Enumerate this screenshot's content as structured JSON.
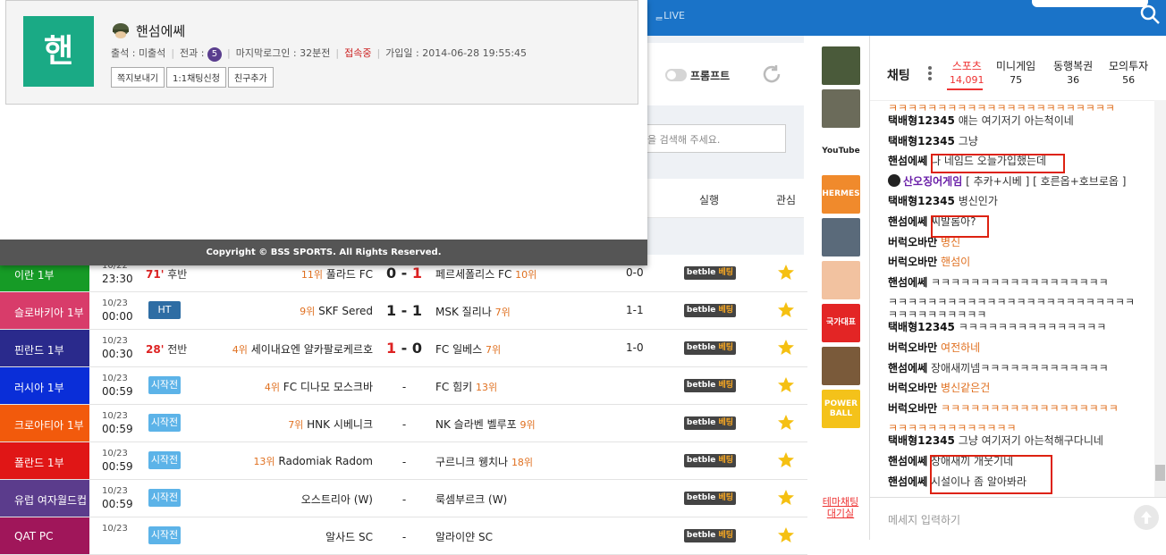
{
  "topbar": {
    "label": "ᆯLIVE"
  },
  "filter": {
    "toggle_label": "프롬프트",
    "search_placeholder": "을 검색해 주세요."
  },
  "table": {
    "header_exec": "실행",
    "header_fav": "관심"
  },
  "matches": [
    {
      "league": "이란 1부",
      "league_color": "#169b26",
      "date": "10/22",
      "time": "23:30",
      "status_type": "live",
      "minute": "71'",
      "phase": "후반",
      "home": "풀라드 FC",
      "home_rank": "11위",
      "score_home": "0",
      "score_away": "1",
      "away": "페르세폴리스 FC",
      "away_rank": "10위",
      "ht": "0-0",
      "bet": "betble",
      "bet2": "베팅"
    },
    {
      "league": "슬로바키아 1부",
      "league_color": "#d83c6a",
      "date": "10/23",
      "time": "00:00",
      "status_type": "ht",
      "status": "HT",
      "home": "SKF Sered",
      "home_rank": "9위",
      "score_home": "1",
      "score_away": "1",
      "away": "MSK 질리나",
      "away_rank": "7위",
      "ht": "1-1",
      "bet": "betble",
      "bet2": "베팅"
    },
    {
      "league": "핀란드 1부",
      "league_color": "#2a2a8c",
      "date": "10/23",
      "time": "00:30",
      "status_type": "live",
      "minute": "28'",
      "phase": "전반",
      "home": "세이내요엔 얄카팔로케르호",
      "home_rank": "4위",
      "score_home": "1",
      "score_away": "0",
      "away": "FC 일베스",
      "away_rank": "7위",
      "ht": "1-0",
      "bet": "betble",
      "bet2": "베팅"
    },
    {
      "league": "러시아 1부",
      "league_color": "#0a2ed8",
      "date": "10/23",
      "time": "00:59",
      "status_type": "pre",
      "status": "시작전",
      "home": "FC 디나모 모스크바",
      "home_rank": "4위",
      "score": "-",
      "away": "FC 힘키",
      "away_rank": "13위",
      "ht": "",
      "bet": "betble",
      "bet2": "베팅"
    },
    {
      "league": "크로아티아 1부",
      "league_color": "#f25a0c",
      "date": "10/23",
      "time": "00:59",
      "status_type": "pre",
      "status": "시작전",
      "home": "HNK 시베니크",
      "home_rank": "7위",
      "score": "-",
      "away": "NK 슬라벤 벨루포",
      "away_rank": "9위",
      "ht": "",
      "bet": "betble",
      "bet2": "베팅"
    },
    {
      "league": "폴란드 1부",
      "league_color": "#e01616",
      "date": "10/23",
      "time": "00:59",
      "status_type": "pre",
      "status": "시작전",
      "home": "Radomiak Radom",
      "home_rank": "13위",
      "score": "-",
      "away": "구르니크 웽치나",
      "away_rank": "18위",
      "ht": "",
      "bet": "betble",
      "bet2": "베팅"
    },
    {
      "league": "유럽 여자월드컵",
      "league_color": "#5b3c8c",
      "date": "10/23",
      "time": "00:59",
      "status_type": "pre",
      "status": "시작전",
      "home": "오스트리아 (W)",
      "home_rank": "",
      "score": "-",
      "away": "룩셈부르크 (W)",
      "away_rank": "",
      "ht": "",
      "bet": "betble",
      "bet2": "베팅"
    },
    {
      "league": "QAT PC",
      "league_color": "#a0165a",
      "date": "10/23",
      "time": "",
      "status_type": "pre",
      "status": "시작전",
      "home": "알사드 SC",
      "home_rank": "",
      "score": "-",
      "away": "알라이얀 SC",
      "away_rank": "",
      "ht": "",
      "bet": "betble",
      "bet2": "베팅"
    }
  ],
  "chat": {
    "title": "채팅",
    "tabs": [
      {
        "label": "스포츠",
        "count": "14,091",
        "active": true
      },
      {
        "label": "미니게임",
        "count": "75"
      },
      {
        "label": "동행복권",
        "count": "36"
      },
      {
        "label": "모의투자",
        "count": "56"
      }
    ],
    "messages": [
      {
        "user": "",
        "text": "ㅋㅋㅋㅋㅋㅋㅋㅋㅋㅋㅋㅋㅋㅋㅋㅋㅋㅋㅋㅋㅋㅋㅋ",
        "style": "o"
      },
      {
        "user": "택배형12345",
        "text": "얘는 여기저기 아는척이네",
        "style": "t"
      },
      {
        "user": "택배형12345",
        "text": "그냥",
        "style": "t"
      },
      {
        "user": "핸섬에쎄",
        "text": "나 네임드 오늘가입했는데",
        "style": "t"
      },
      {
        "user": "산오징어게임",
        "text": "[ 추카+시베 ] [ 호른옵+호브로옵 ]",
        "style": "t"
      },
      {
        "user": "택배형12345",
        "text": "병신인가",
        "style": "t"
      },
      {
        "user": "핸섬에쎄",
        "text": "씨발롬아?",
        "style": "t"
      },
      {
        "user": "버럭오바만",
        "text": "병신",
        "style": "o"
      },
      {
        "user": "버럭오바만",
        "text": "핸섬이",
        "style": "o"
      },
      {
        "user": "핸섬에쎄",
        "text": "ㅋㅋㅋㅋㅋㅋㅋㅋㅋㅋㅋㅋㅋㅋㅋㅋㅋㅋ",
        "style": "t"
      },
      {
        "user": "",
        "text": "ㅋㅋㅋㅋㅋㅋㅋㅋㅋㅋㅋㅋㅋㅋㅋㅋㅋㅋㅋㅋㅋㅋㅋㅋㅋ",
        "style": "t"
      },
      {
        "user": "",
        "text": "ㅋㅋㅋㅋㅋㅋㅋㅋㅋㅋ",
        "style": "t"
      },
      {
        "user": "택배형12345",
        "text": "ㅋㅋㅋㅋㅋㅋㅋㅋㅋㅋㅋㅋㅋㅋㅋ",
        "style": "t"
      },
      {
        "user": "버럭오바만",
        "text": "여전하네",
        "style": "o"
      },
      {
        "user": "핸섬에쎄",
        "text": "장애새끼넴ㅋㅋㅋㅋㅋㅋㅋㅋㅋㅋㅋㅋㅋ",
        "style": "t"
      },
      {
        "user": "버럭오바만",
        "text": "병신같은건",
        "style": "o"
      },
      {
        "user": "버럭오바만",
        "text": "ㅋㅋㅋㅋㅋㅋㅋㅋㅋㅋㅋㅋㅋㅋㅋㅋㅋㅋ",
        "style": "o"
      },
      {
        "user": "",
        "text": "ㅋㅋㅋㅋㅋㅋㅋㅋㅋㅋㅋㅋㅋ",
        "style": "o"
      },
      {
        "user": "택배형12345",
        "text": "그냥 여기저기 아는척해구다니네",
        "style": "t"
      },
      {
        "user": "핸섬에쎄",
        "text": "장애새끼 개웃기네",
        "style": "t"
      },
      {
        "user": "핸섬에쎄",
        "text": "시설이나 좀 알아봐라",
        "style": "t"
      }
    ],
    "input_placeholder": "메세지 입력하기",
    "topic_label_1": "테마채팅",
    "topic_label_2": "대기실"
  },
  "popup": {
    "avatar_char": "핸",
    "nickname": "핸섬에쎄",
    "attend_label": "출석 : 미출석",
    "record_label": "전과 :",
    "record_count": "5",
    "last_login": "마지막로그인 : 32분전",
    "online": "접속중",
    "join_date": "가입일 : 2014-06-28 19:55:45",
    "btn_message": "쪽지보내기",
    "btn_chat": "1:1채팅신청",
    "btn_friend": "친구추가",
    "footer": "Copyright © BSS SPORTS. All Rights Reserved."
  },
  "thumbs": [
    {
      "name": "joker",
      "color": "#4a5a3a"
    },
    {
      "name": "man-portrait",
      "color": "#6b6b5a"
    },
    {
      "name": "youtube",
      "color": "#ffffff",
      "label": "YouTube"
    },
    {
      "name": "hermes",
      "color": "#f08a2c",
      "label": "HERMES"
    },
    {
      "name": "man-news",
      "color": "#5a6a7a"
    },
    {
      "name": "cartoon-face",
      "color": "#f2c2a0"
    },
    {
      "name": "korea-rep",
      "color": "#e32525",
      "label": "국가대표"
    },
    {
      "name": "child-portrait",
      "color": "#7a5a3a"
    },
    {
      "name": "powerball",
      "color": "#f4c21a",
      "label": "POWER BALL"
    }
  ]
}
